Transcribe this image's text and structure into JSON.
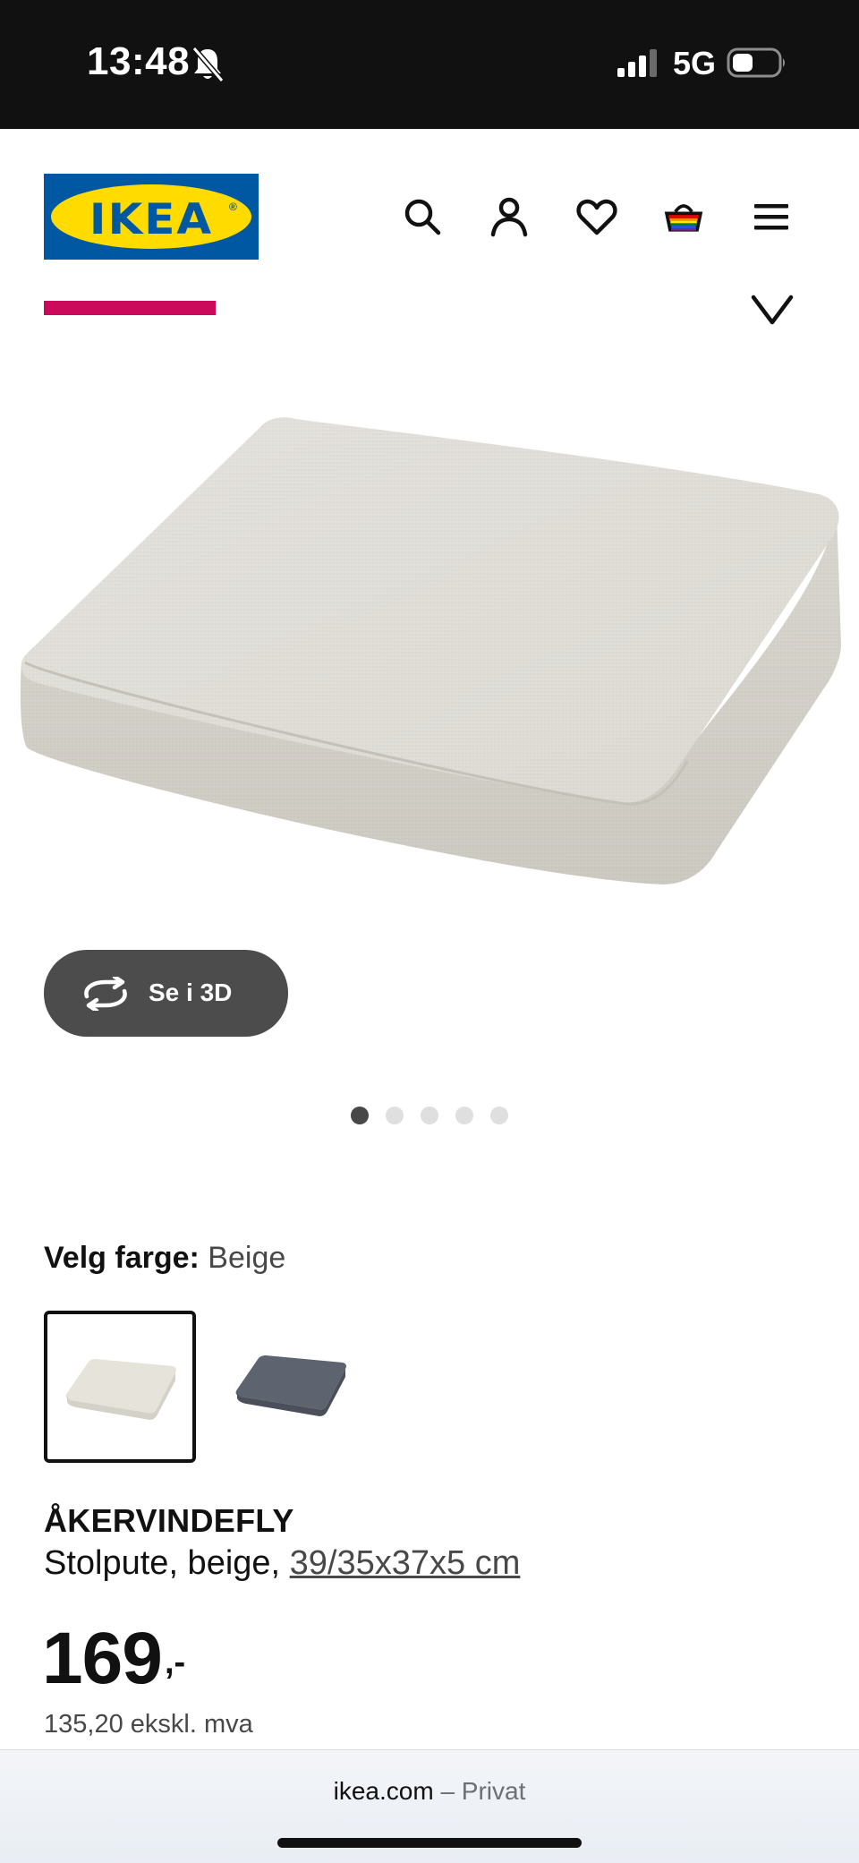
{
  "status_bar": {
    "time": "13:48",
    "silent_icon": "bell-slash-icon",
    "network": "5G",
    "signal_icon": "signal-bars-icon",
    "battery_icon": "battery-icon"
  },
  "header": {
    "logo_text": "IKEA",
    "icons": [
      "search-icon",
      "user-icon",
      "heart-icon",
      "basket-icon",
      "menu-icon"
    ],
    "brand_colors": {
      "blue": "#0058a3",
      "yellow": "#ffdb00"
    }
  },
  "gallery": {
    "view3d_label": "Se i 3D",
    "dot_count": 5,
    "active_dot": 1
  },
  "color_picker": {
    "label": "Velg farge:",
    "selected_value": "Beige",
    "swatches": [
      {
        "name": "beige",
        "color": "#e6e3da",
        "selected": true
      },
      {
        "name": "grey-blue",
        "color": "#585e6a",
        "selected": false
      }
    ]
  },
  "product": {
    "name": "ÅKERVINDEFLY",
    "description": "Stolpute, beige, ",
    "size_link": "39/35x37x5 cm",
    "price": "169",
    "price_suffix": ",-",
    "price_ex_vat": "135,20 ekskl. mva"
  },
  "browser": {
    "domain": "ikea.com",
    "separator": "–",
    "mode": "Privat"
  }
}
